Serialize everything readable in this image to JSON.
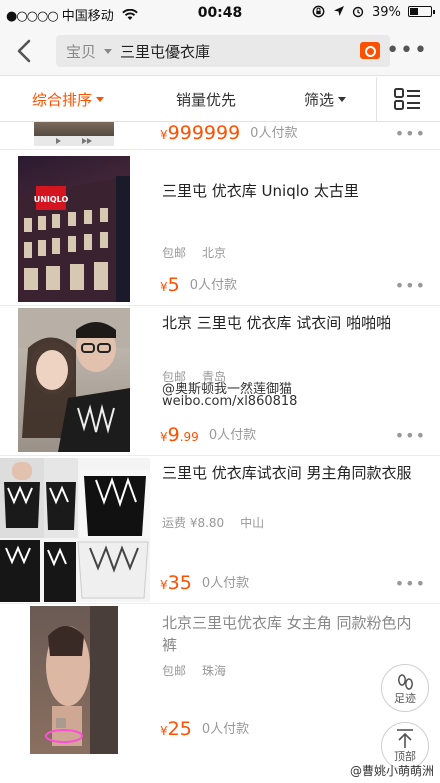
{
  "status_bar": {
    "carrier": "中国移动",
    "time": "00:48",
    "battery": "39%",
    "battery_level": 0.39
  },
  "search": {
    "scope": "宝贝",
    "query": "三里屯優衣庫"
  },
  "filters": {
    "sort": "综合排序",
    "sales": "销量优先",
    "filter": "筛选"
  },
  "items": [
    {
      "currency": "¥",
      "price": "999999",
      "paid": "0人付款"
    },
    {
      "title": "三里屯 优衣库 Uniqlo 太古里",
      "shipping": "包邮",
      "location": "北京",
      "currency": "¥",
      "price": "5",
      "paid": "0人付款",
      "image_text": "UNIQLO"
    },
    {
      "title": "北京 三里屯 优衣库 试衣间 啪啪啪",
      "shipping": "包邮",
      "location": "青岛",
      "currency": "¥",
      "price": "9",
      "price_decimal": ".99",
      "paid": "0人付款",
      "watermark_line1": "@奥斯顿我一然莲御猫",
      "watermark_line2": "weibo.com/xl860818"
    },
    {
      "title": "三里屯 优衣库试衣间 男主角同款衣服",
      "shipping": "运费 ¥8.80",
      "location": "中山",
      "currency": "¥",
      "price": "35",
      "paid": "0人付款"
    },
    {
      "title": "北京三里屯优衣库 女主角 同款粉色内裤",
      "shipping": "包邮",
      "location": "珠海",
      "currency": "¥",
      "price": "25",
      "paid": "0人付款"
    }
  ],
  "floating": {
    "footprint": "足迹",
    "top": "顶部"
  },
  "bottom_watermark": "@曹姚小萌萌洲"
}
